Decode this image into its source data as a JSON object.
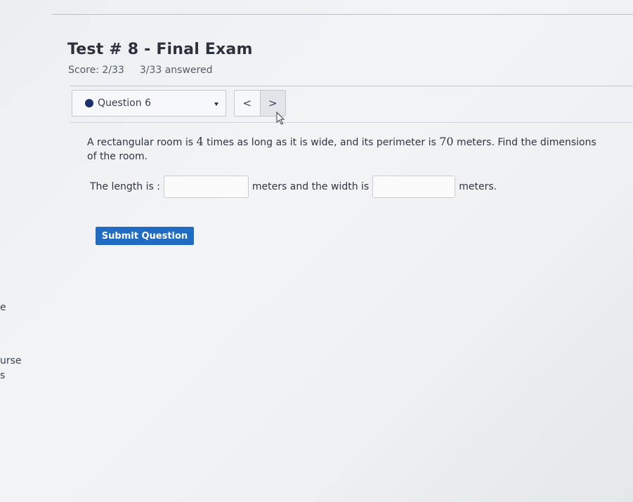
{
  "test": {
    "title": "Test # 8 - Final Exam",
    "score": "Score: 2/33",
    "answered": "3/33 answered"
  },
  "question_selector": {
    "label": "Question 6"
  },
  "nav": {
    "prev": "<",
    "next": ">"
  },
  "question": {
    "text_1": "A rectangular room is ",
    "num_1": "4",
    "text_2": " times as long as it is wide, and its perimeter is ",
    "num_2": "70",
    "text_3": " meters. Find the dimensions of the room."
  },
  "answer": {
    "prefix": "The length is :",
    "middle": "meters and the width is",
    "suffix": "meters.",
    "length_value": "",
    "width_value": ""
  },
  "submit": {
    "label": "Submit Question"
  },
  "sidebar_fragments": {
    "a": "e",
    "b": "urse",
    "c": "s"
  },
  "colors": {
    "accent": "#1f6cc2",
    "dot": "#1c2f6b"
  }
}
